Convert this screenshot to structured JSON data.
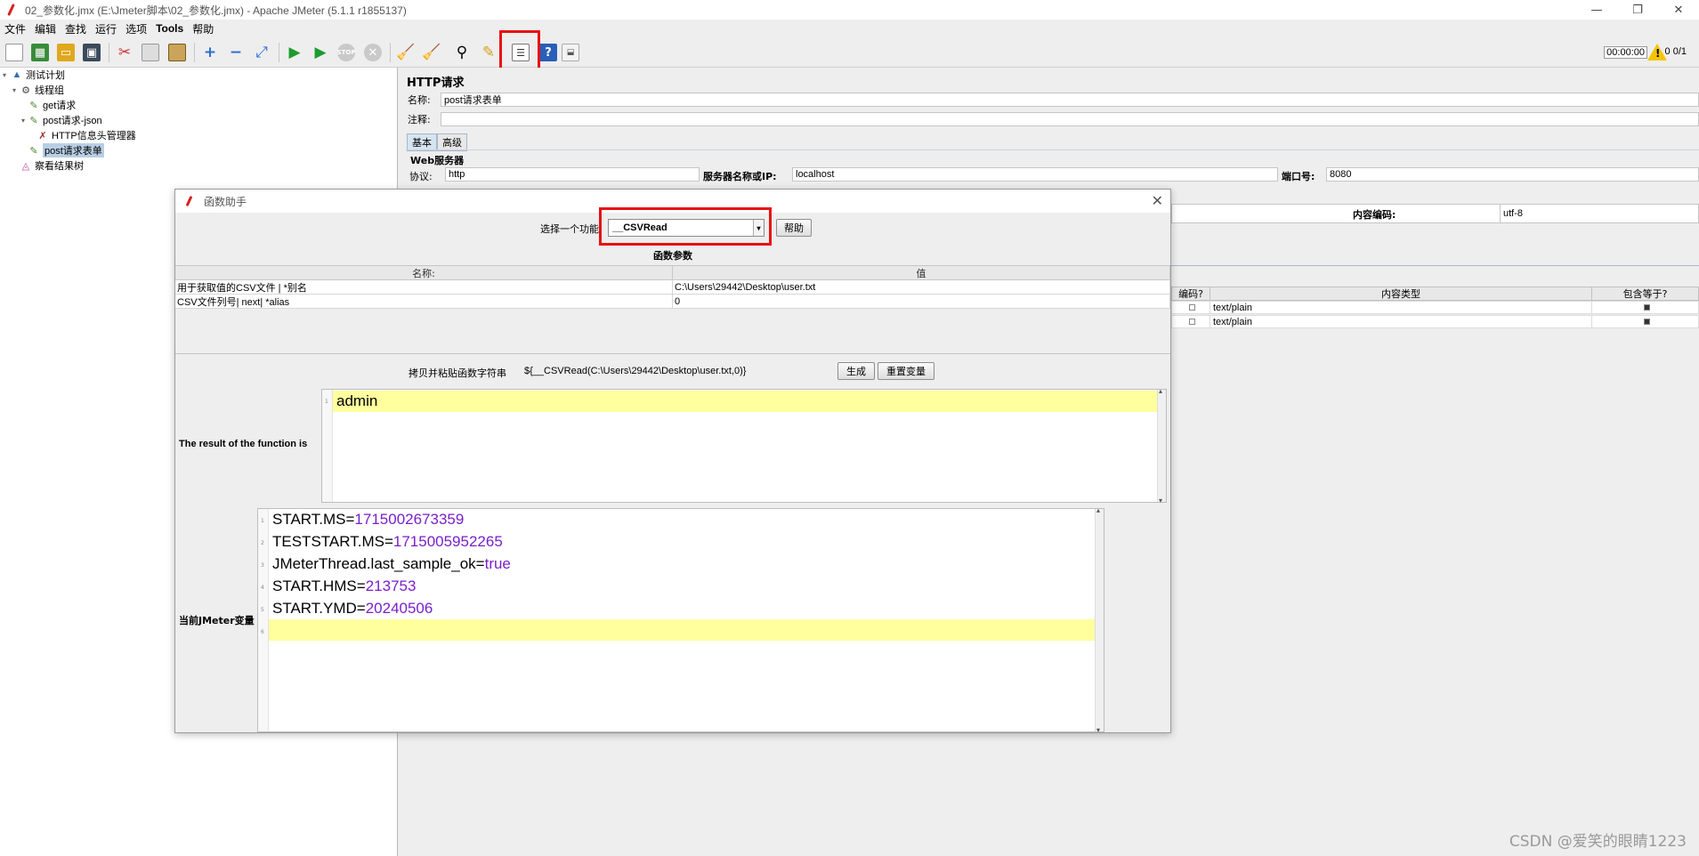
{
  "window": {
    "title": "02_参数化.jmx (E:\\Jmeter脚本\\02_参数化.jmx) - Apache JMeter (5.1.1 r1855137)",
    "controls": [
      "—",
      "❐",
      "✕"
    ]
  },
  "menu": [
    "文件",
    "编辑",
    "查找",
    "运行",
    "选项",
    "Tools",
    "帮助"
  ],
  "toolbar": {
    "timer": "00:00:00",
    "counts": "0 0/1"
  },
  "tree": {
    "items": [
      {
        "label": "测试计划",
        "icon": "test-plan-icon"
      },
      {
        "label": "线程组",
        "icon": "thread-group-icon"
      },
      {
        "label": "get请求",
        "icon": "sampler-icon"
      },
      {
        "label": "post请求-json",
        "icon": "sampler-icon"
      },
      {
        "label": "HTTP信息头管理器",
        "icon": "config-icon"
      },
      {
        "label": "post请求表单",
        "icon": "sampler-icon"
      },
      {
        "label": "察看结果树",
        "icon": "listener-icon"
      }
    ]
  },
  "http_request": {
    "title": "HTTP请求",
    "name_label": "名称:",
    "name_value": "post请求表单",
    "comment_label": "注释:",
    "tabs": [
      "基本",
      "高级"
    ],
    "web_server": "Web服务器",
    "protocol_label": "协议:",
    "protocol_value": "http",
    "server_label": "服务器名称或IP:",
    "server_value": "localhost",
    "port_label": "端口号:",
    "port_value": "8080",
    "encoding_label": "内容编码:",
    "encoding_value": "utf-8",
    "params_headers": [
      "编码?",
      "内容类型",
      "包含等于?"
    ],
    "params_rows": [
      {
        "content_type": "text/plain"
      },
      {
        "content_type": "text/plain"
      }
    ]
  },
  "dialog": {
    "title": "函数助手",
    "select_label": "选择一个功能",
    "selected_function": "__CSVRead",
    "help_button": "帮助",
    "params_title": "函数参数",
    "table_headers": [
      "名称:",
      "值"
    ],
    "table_rows": [
      {
        "name": "用于获取值的CSV文件 | *别名",
        "value": "C:\\Users\\29442\\Desktop\\user.txt"
      },
      {
        "name": "CSV文件列号| next| *alias",
        "value": "0"
      }
    ],
    "copy_label": "拷贝并粘贴函数字符串",
    "function_string": "${__CSVRead(C:\\Users\\29442\\Desktop\\user.txt,0)}",
    "generate_button": "生成",
    "reset_button": "重置变量",
    "result_label": "The result of the function is",
    "result_value": "admin",
    "vars_label": "当前JMeter变量",
    "vars": [
      {
        "key": "START.MS=",
        "value": "1715002673359"
      },
      {
        "key": "TESTSTART.MS=",
        "value": "1715005952265"
      },
      {
        "key": "JMeterThread.last_sample_ok=",
        "value": "true"
      },
      {
        "key": "START.HMS=",
        "value": "213753"
      },
      {
        "key": "START.YMD=",
        "value": "20240506"
      }
    ]
  },
  "watermark": "CSDN @爱笑的眼睛1223",
  "colors": {
    "highlight": "#e81010",
    "selected_line": "#ffff9e",
    "var_value": "#7a1fc9"
  }
}
